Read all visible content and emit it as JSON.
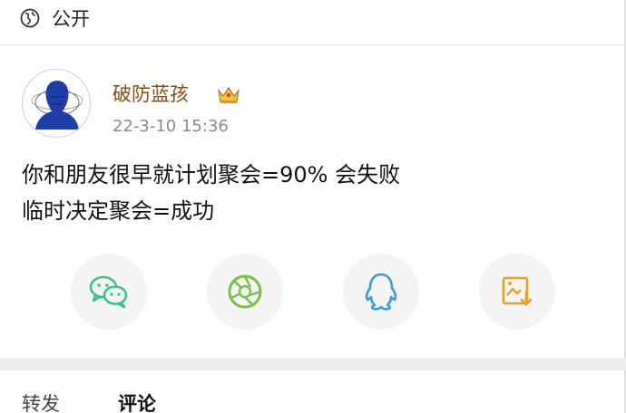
{
  "header": {
    "visibility_label": "公开",
    "visibility_icon": "globe-icon"
  },
  "post": {
    "author": "破防蓝孩",
    "badge_icon": "crown-icon",
    "timestamp": "22-3-10 15:36",
    "lines": [
      "你和朋友很早就计划聚会=90% 会失败",
      "临时决定聚会=成功"
    ]
  },
  "share": [
    {
      "name": "wechat",
      "icon": "wechat-icon",
      "color": "#3fbf8a"
    },
    {
      "name": "moments",
      "icon": "aperture-icon",
      "color": "#7ac143"
    },
    {
      "name": "qq",
      "icon": "penguin-icon",
      "color": "#3a9bd5"
    },
    {
      "name": "save-image",
      "icon": "image-download-icon",
      "color": "#e0a620"
    }
  ],
  "tabs": {
    "repost": "转发",
    "comment": "评论"
  }
}
